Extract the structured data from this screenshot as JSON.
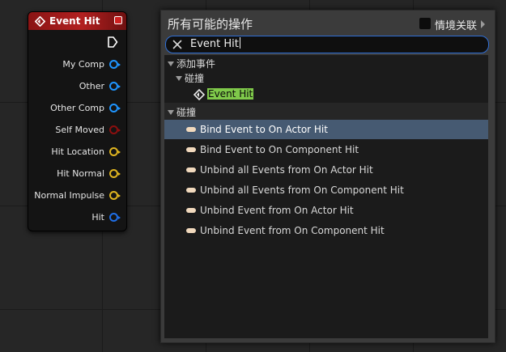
{
  "node": {
    "title": "Event Hit",
    "pins": [
      {
        "label": "My Comp",
        "color": "#1f95ff"
      },
      {
        "label": "Other",
        "color": "#1f95ff"
      },
      {
        "label": "Other Comp",
        "color": "#1f95ff"
      },
      {
        "label": "Self Moved",
        "color": "#8c0f0f"
      },
      {
        "label": "Hit Location",
        "color": "#e0b520"
      },
      {
        "label": "Hit Normal",
        "color": "#e0b520"
      },
      {
        "label": "Normal Impulse",
        "color": "#e0b520"
      },
      {
        "label": "Hit",
        "color": "#1f6ee6"
      }
    ]
  },
  "menu": {
    "title": "所有可能的操作",
    "context_label": "情境关联",
    "search_value": "Event Hit",
    "tree": {
      "category_add_event": "添加事件",
      "subcategory_collision": "碰撞",
      "event_item": "Event Hit",
      "category_collision": "碰撞",
      "actions": [
        "Bind Event to On Actor Hit",
        "Bind Event to On Component Hit",
        "Unbind all Events from On Actor Hit",
        "Unbind all Events from On Component Hit",
        "Unbind Event from On Actor Hit",
        "Unbind Event from On Component Hit"
      ]
    }
  },
  "colors": {
    "node_header": "#b22020",
    "selection": "#465a72",
    "search_highlight": "#7fc94a",
    "search_border": "#2f6fd6"
  }
}
